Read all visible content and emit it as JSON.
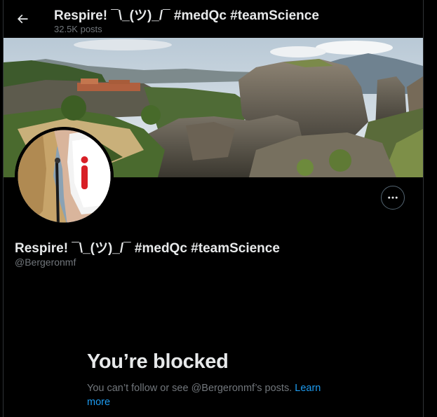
{
  "header": {
    "back_icon": "arrow-left-icon",
    "title": "Respire! ¯\\_(ツ)_/¯ #medQc #teamScience",
    "post_count": "32.5K posts"
  },
  "profile": {
    "display_name": "Respire! ¯\\_(ツ)_/¯ #medQc #teamScience",
    "handle": "@Bergeronmf",
    "more_icon": "more-horizontal-icon"
  },
  "blocked": {
    "title": "You’re blocked",
    "message": "You can’t follow or see @Bergeronmf’s posts. ",
    "link": "Learn more"
  },
  "colors": {
    "background": "#000000",
    "primary_text": "#e7e9ea",
    "secondary_text": "#71767b",
    "link": "#1d9bf0",
    "border": "#2f3336"
  }
}
